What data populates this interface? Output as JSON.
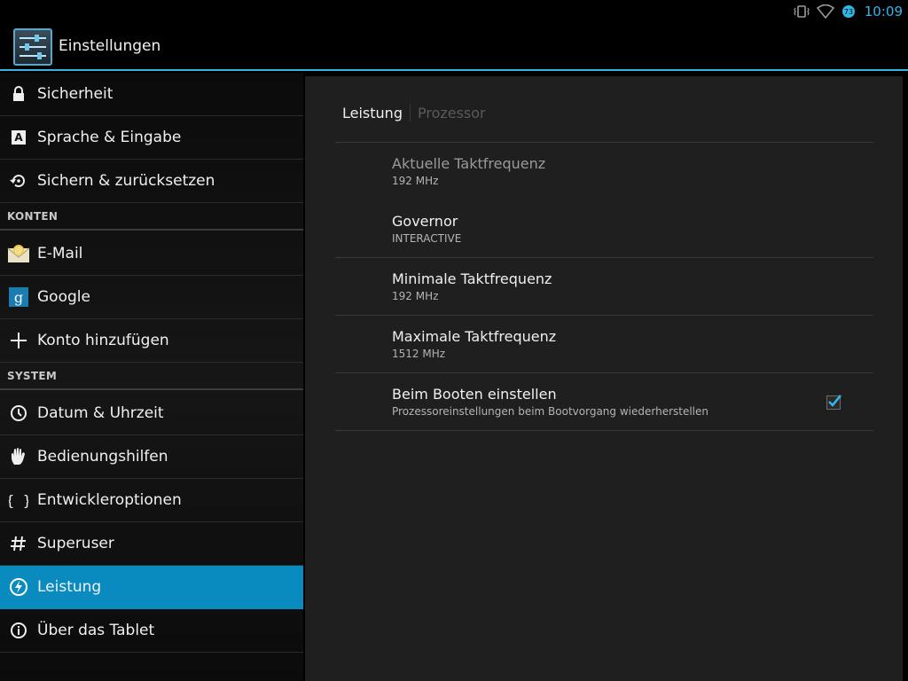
{
  "status": {
    "time": "10:09",
    "battery_level": "73",
    "accent": "#33b5e5"
  },
  "app": {
    "title": "Einstellungen",
    "icon": "settings-sliders-icon"
  },
  "sidebar": {
    "items": [
      {
        "label": "Sicherheit",
        "icon": "lock-icon"
      },
      {
        "label": "Sprache & Eingabe",
        "icon": "language-icon"
      },
      {
        "label": "Sichern & zurücksetzen",
        "icon": "backup-icon"
      }
    ],
    "section_accounts": "KONTEN",
    "accounts": [
      {
        "label": "E-Mail",
        "icon": "email-icon"
      },
      {
        "label": "Google",
        "icon": "google-icon"
      },
      {
        "label": "Konto hinzufügen",
        "icon": "add-icon"
      }
    ],
    "section_system": "SYSTEM",
    "system": [
      {
        "label": "Datum & Uhrzeit",
        "icon": "clock-icon"
      },
      {
        "label": "Bedienungshilfen",
        "icon": "hand-icon"
      },
      {
        "label": "Entwickleroptionen",
        "icon": "braces-icon"
      },
      {
        "label": "Superuser",
        "icon": "hash-icon"
      },
      {
        "label": "Leistung",
        "icon": "performance-icon",
        "active": true
      },
      {
        "label": "Über das Tablet",
        "icon": "info-icon"
      }
    ],
    "active_color": "#0a8bbf"
  },
  "main": {
    "tabs": [
      {
        "label": "Leistung",
        "active": true
      },
      {
        "label": "Prozessor",
        "active": false
      }
    ],
    "prefs": [
      {
        "title": "Aktuelle Taktfrequenz",
        "summary": "192 MHz"
      },
      {
        "title": "Governor",
        "summary": "INTERACTIVE"
      },
      {
        "title": "Minimale Taktfrequenz",
        "summary": "192 MHz"
      },
      {
        "title": "Maximale Taktfrequenz",
        "summary": "1512 MHz"
      },
      {
        "title": "Beim Booten einstellen",
        "summary": "Prozessoreinstellungen beim Bootvorgang wiederherstellen",
        "checked": true
      }
    ]
  }
}
